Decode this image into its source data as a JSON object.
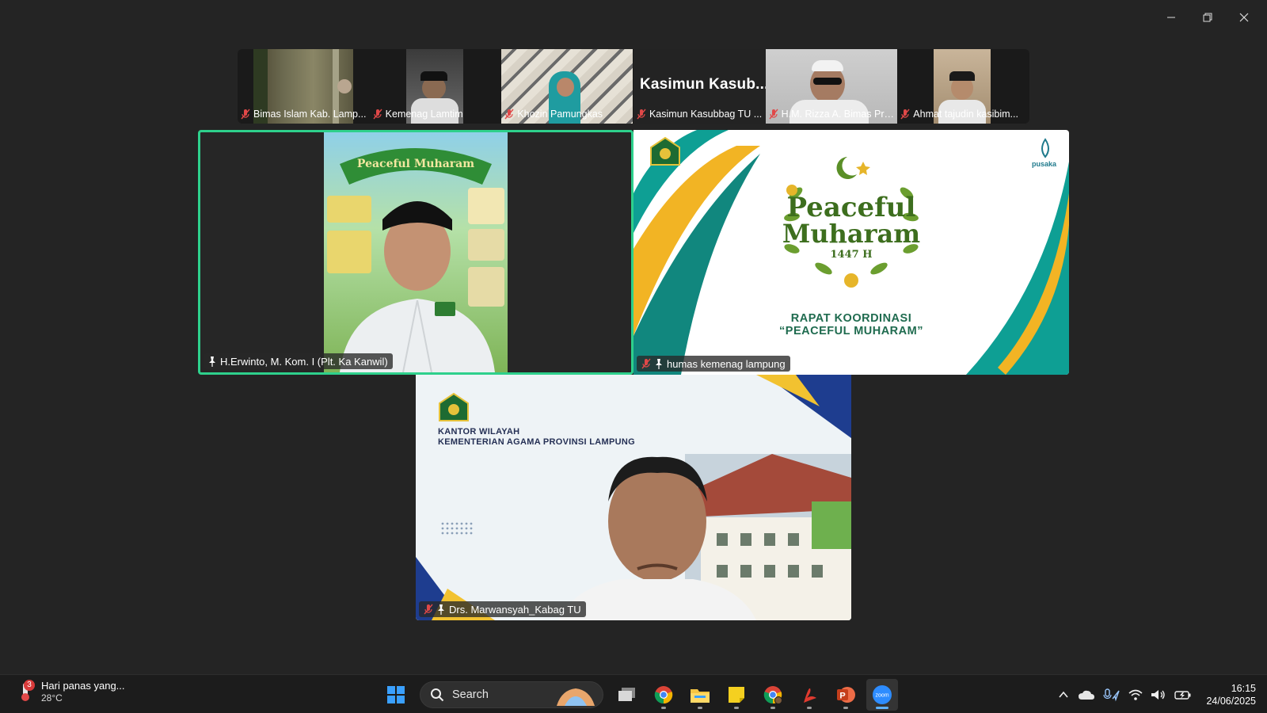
{
  "window": {
    "controls": [
      "minimize",
      "restore",
      "close"
    ]
  },
  "participants_strip": [
    {
      "name": "Bimas Islam Kab. Lamp...",
      "muted": true
    },
    {
      "name": "Kemenag Lamtim",
      "muted": true
    },
    {
      "name": "Khozin Pamungkas",
      "muted": true
    },
    {
      "name": "Kasimun Kasubbag TU ...",
      "muted": true,
      "display_name": "Kasimun  Kasub..."
    },
    {
      "name": "H.M. Rizza A. Bimas Pri...",
      "muted": true
    },
    {
      "name": "Ahmat tajudin kasibim...",
      "muted": true
    }
  ],
  "main_tiles": {
    "speaker": {
      "name": "H.Erwinto, M. Kom. I (Plt. Ka Kanwil)",
      "pinned": true,
      "muted": false,
      "active_speaker_color": "#2ed08c"
    },
    "shared": {
      "name": "humas kemenag lampung",
      "pinned": true,
      "muted": true,
      "poster": {
        "title_line1": "Peaceful",
        "title_line2": "Muharam",
        "year": "1447 H",
        "subtitle_line1": "RAPAT KOORDINASI",
        "subtitle_line2": "“PEACEFUL MUHARAM”",
        "brand": "pusaka"
      }
    },
    "bottom": {
      "name": "Drs. Marwansyah_Kabag TU",
      "pinned": true,
      "muted": true,
      "background_text_line1": "KANTOR WILAYAH",
      "background_text_line2": "KEMENTERIAN AGAMA PROVINSI LAMPUNG"
    }
  },
  "taskbar": {
    "weather": {
      "badge": "3",
      "text": "Hari panas yang...",
      "temp": "28°C"
    },
    "search_placeholder": "Search",
    "apps": [
      "start-icon",
      "task-view-icon",
      "chrome-icon",
      "file-explorer-icon",
      "sticky-notes-icon",
      "chrome-profile-icon",
      "acrobat-icon",
      "powerpoint-icon",
      "zoom-icon"
    ],
    "active_app": "zoom-icon",
    "zoom_label": "zoom",
    "clock": {
      "time": "16:15",
      "date": "24/06/2025"
    }
  }
}
